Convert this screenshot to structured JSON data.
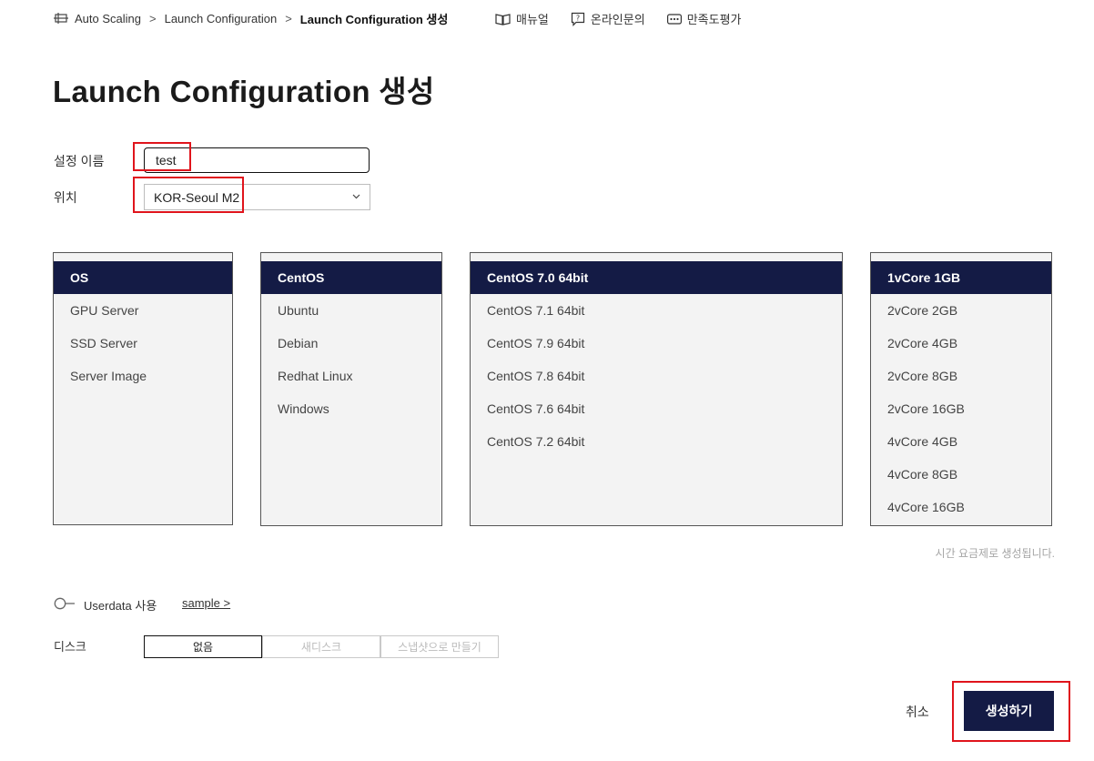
{
  "breadcrumb": {
    "items": [
      "Auto Scaling",
      "Launch Configuration"
    ],
    "separator": ">",
    "current": "Launch Configuration 생성"
  },
  "top_links": {
    "manual": "매뉴얼",
    "inquiry": "온라인문의",
    "survey": "만족도평가"
  },
  "page_title": "Launch Configuration 생성",
  "form": {
    "name_label": "설정 이름",
    "name_value": "test",
    "location_label": "위치",
    "location_value": "KOR-Seoul M2"
  },
  "lists": {
    "category": [
      "OS",
      "GPU Server",
      "SSD Server",
      "Server Image"
    ],
    "os": [
      "CentOS",
      "Ubuntu",
      "Debian",
      "Redhat Linux",
      "Windows"
    ],
    "version": [
      "CentOS 7.0 64bit",
      "CentOS 7.1 64bit",
      "CentOS 7.9 64bit",
      "CentOS 7.8 64bit",
      "CentOS 7.6 64bit",
      "CentOS 7.2 64bit"
    ],
    "spec": [
      "1vCore 1GB",
      "2vCore 2GB",
      "2vCore 4GB",
      "2vCore 8GB",
      "2vCore 16GB",
      "4vCore 4GB",
      "4vCore 8GB",
      "4vCore 16GB"
    ]
  },
  "billing_hint": "시간 요금제로 생성됩니다.",
  "userdata": {
    "label": "Userdata 사용",
    "enabled": false,
    "sample_link": "sample >"
  },
  "disk": {
    "label": "디스크",
    "options": [
      "없음",
      "새디스크",
      "스냅샷으로 만들기"
    ],
    "selected": "없음"
  },
  "actions": {
    "cancel": "취소",
    "create": "생성하기"
  },
  "colors": {
    "primary": "#141b45",
    "highlight": "#e0141c",
    "panel_bg": "#f3f3f3"
  }
}
